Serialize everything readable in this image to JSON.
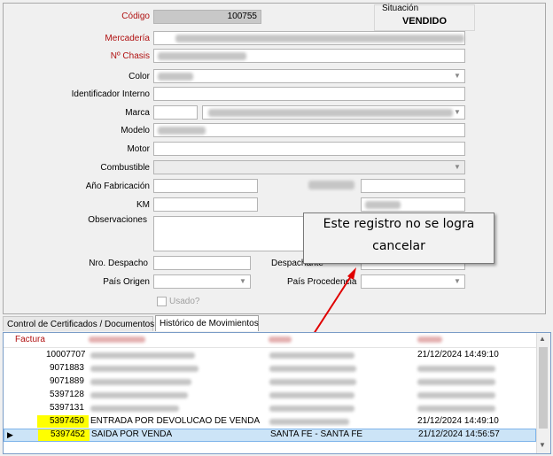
{
  "form": {
    "codigo_label": "Código",
    "codigo_value": "100755",
    "mercaderia_label": "Mercadería",
    "chasis_label": "Nº Chasis",
    "color_label": "Color",
    "identificador_label": "Identificador Interno",
    "marca_label": "Marca",
    "modelo_label": "Modelo",
    "motor_label": "Motor",
    "combustible_label": "Combustible",
    "anio_label": "Año Fabricación",
    "km_label": "KM",
    "observaciones_label": "Observaciones",
    "despacho_label": "Nro. Despacho",
    "despachante_label": "Despachante",
    "pais_origen_label": "País Origen",
    "pais_procedencia_label": "País Procedencia",
    "usado_label": "Usado?"
  },
  "situacion": {
    "label": "Situación",
    "value": "VENDIDO"
  },
  "callout": {
    "line1": "Este registro no se logra",
    "line2": "cancelar"
  },
  "tabs": [
    {
      "label": "Control de Certificados / Documentos"
    },
    {
      "label": "Histórico de Movimientos"
    }
  ],
  "grid": {
    "factura_header": "Factura",
    "rows": [
      {
        "factura": "10007707",
        "tipo": "",
        "local": "",
        "fecha": "21/12/2024 14:49:10"
      },
      {
        "factura": "9071883",
        "tipo": "",
        "local": "",
        "fecha": ""
      },
      {
        "factura": "9071889",
        "tipo": "",
        "local": "",
        "fecha": ""
      },
      {
        "factura": "5397128",
        "tipo": "",
        "local": "",
        "fecha": ""
      },
      {
        "factura": "5397131",
        "tipo": "",
        "local": "",
        "fecha": ""
      },
      {
        "factura": "5397450",
        "tipo": "ENTRADA POR DEVOLUCAO DE VENDA",
        "local": "",
        "fecha": "21/12/2024 14:49:10"
      },
      {
        "factura": "5397452",
        "tipo": "SAIDA POR VENDA",
        "local": "SANTA FE - SANTA FE",
        "fecha": "21/12/2024 14:56:57"
      }
    ]
  },
  "colors": {
    "required_label": "#b01010",
    "highlight": "#ffff00",
    "selected_row": "#cce4f7",
    "arrow": "#e00000"
  }
}
